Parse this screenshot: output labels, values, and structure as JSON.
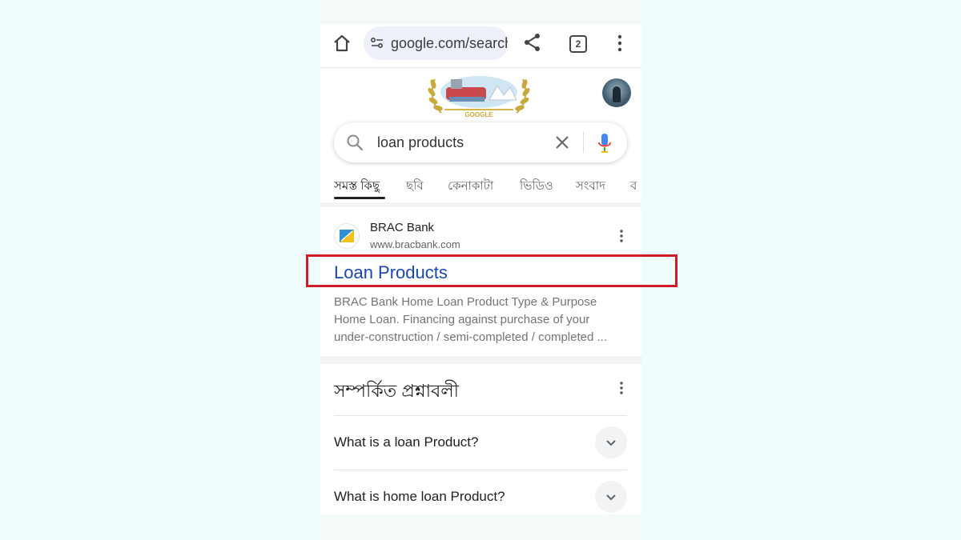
{
  "browser": {
    "url": "google.com/search",
    "tab_count": "2"
  },
  "doodle": {
    "wordmark": "GOOGLE"
  },
  "search": {
    "query": "loan products"
  },
  "tabs": [
    "সমস্ত কিছু",
    "ছবি",
    "কেনাকাটা",
    "ভিডিও",
    "সংবাদ",
    "ব"
  ],
  "result": {
    "site_name": "BRAC Bank",
    "site_url": "www.bracbank.com",
    "title": "Loan Products",
    "snippet_lines": [
      "BRAC Bank Home Loan Product Type & Purpose",
      "Home Loan. Financing against purchase of your",
      "under-construction / semi-completed / completed ..."
    ]
  },
  "related": {
    "title": "সম্পর্কিত প্রশ্নাবলী",
    "questions": [
      "What is a loan Product?",
      "What is home loan Product?"
    ]
  },
  "colors": {
    "link": "#1a46b5",
    "highlight": "#d11b25",
    "page_bg": "#effdfd"
  },
  "icons": [
    "home-icon",
    "site-settings-icon",
    "share-icon",
    "tab-switcher-icon",
    "more-vert-icon",
    "search-icon",
    "clear-icon",
    "mic-icon",
    "chevron-down-icon"
  ]
}
